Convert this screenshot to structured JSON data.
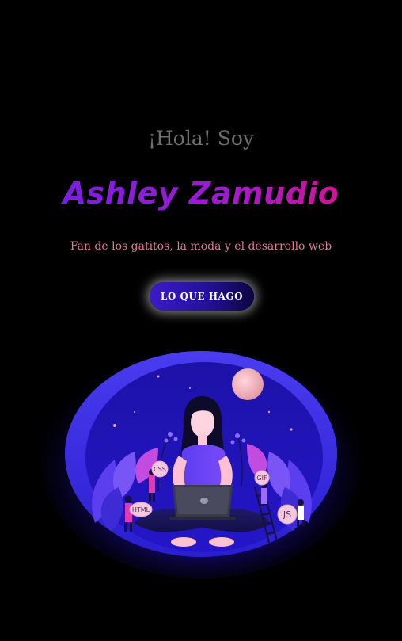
{
  "hero": {
    "greeting": "¡Hola! Soy",
    "name": "Ashley Zamudio",
    "tagline": "Fan de los gatitos, la moda y el desarrollo web",
    "cta_label": "LO QUE HAGO"
  },
  "illustration": {
    "badges": {
      "css": "CSS",
      "html": "HTML",
      "gif": "GIF",
      "js": "JS"
    }
  },
  "colors": {
    "background": "#000000",
    "greeting": "#6e6e6e",
    "name_gradient_start": "#6d1fe8",
    "name_gradient_end": "#e6127a",
    "tagline": "#e07a9a",
    "button_start": "#3b1bc9",
    "button_end": "#0b0640",
    "illustration_blue": "#2b20e0"
  },
  "icons": [
    "moon-icon",
    "laptop-icon",
    "css-badge-icon",
    "html-badge-icon",
    "gif-badge-icon",
    "js-badge-icon"
  ]
}
